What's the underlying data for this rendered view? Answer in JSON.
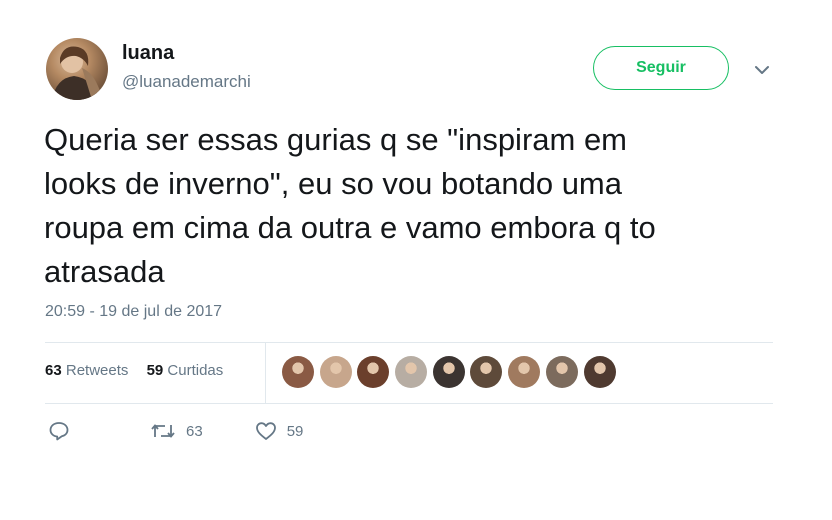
{
  "user": {
    "name": "luana",
    "handle": "@luanademarchi"
  },
  "follow_button": {
    "label": "Seguir",
    "color": "#17bf63"
  },
  "menu": {
    "icon": "chevron-down-icon"
  },
  "tweet": {
    "text": "Queria ser essas gurias q se \"inspiram em\nlooks de inverno\", eu so vou botando uma\nroupa em cima da outra e vamo embora q to\natrasada",
    "timestamp": "20:59 - 19 de jul de 2017"
  },
  "stats": {
    "retweets_count": "63",
    "retweets_label": "Retweets",
    "likes_count": "59",
    "likes_label": "Curtidas"
  },
  "likers": [
    {
      "color": "#8a5a44"
    },
    {
      "color": "#c7a68c"
    },
    {
      "color": "#6b3f2c"
    },
    {
      "color": "#b7ada3"
    },
    {
      "color": "#3b3431"
    },
    {
      "color": "#5e4a3a"
    },
    {
      "color": "#a07a5f"
    },
    {
      "color": "#7c6b5d"
    },
    {
      "color": "#4f3a30"
    }
  ],
  "actions": {
    "reply_icon": "reply-icon",
    "retweet_icon": "retweet-icon",
    "retweet_count": "63",
    "like_icon": "heart-icon",
    "like_count": "59"
  }
}
